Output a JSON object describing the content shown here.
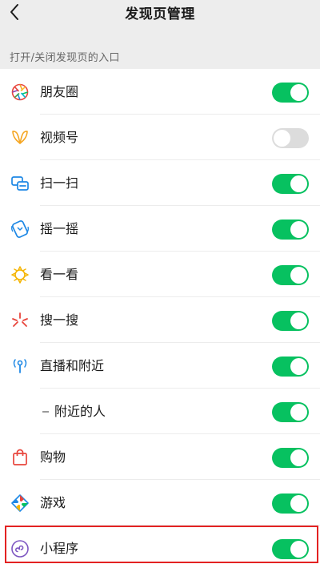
{
  "header": {
    "title": "发现页管理",
    "back_icon": "chevron-left-icon"
  },
  "section": {
    "title": "打开/关闭发现页的入口"
  },
  "items": [
    {
      "label": "朋友圈",
      "icon": "moments-icon",
      "enabled": true
    },
    {
      "label": "视频号",
      "icon": "channels-icon",
      "enabled": false
    },
    {
      "label": "扫一扫",
      "icon": "scan-icon",
      "enabled": true
    },
    {
      "label": "摇一摇",
      "icon": "shake-icon",
      "enabled": true
    },
    {
      "label": "看一看",
      "icon": "top-stories-icon",
      "enabled": true
    },
    {
      "label": "搜一搜",
      "icon": "search-icon",
      "enabled": true
    },
    {
      "label": "直播和附近",
      "icon": "live-nearby-icon",
      "enabled": true
    },
    {
      "label": "附近的人",
      "icon": "",
      "enabled": true,
      "sub": true
    },
    {
      "label": "购物",
      "icon": "shopping-bag-icon",
      "enabled": true
    },
    {
      "label": "游戏",
      "icon": "games-icon",
      "enabled": true
    },
    {
      "label": "小程序",
      "icon": "mini-programs-icon",
      "enabled": true,
      "highlighted": true
    }
  ],
  "colors": {
    "toggle_on": "#07c160",
    "toggle_off": "#dcdcdc",
    "highlight_border": "#e32222",
    "background": "#ededed"
  }
}
